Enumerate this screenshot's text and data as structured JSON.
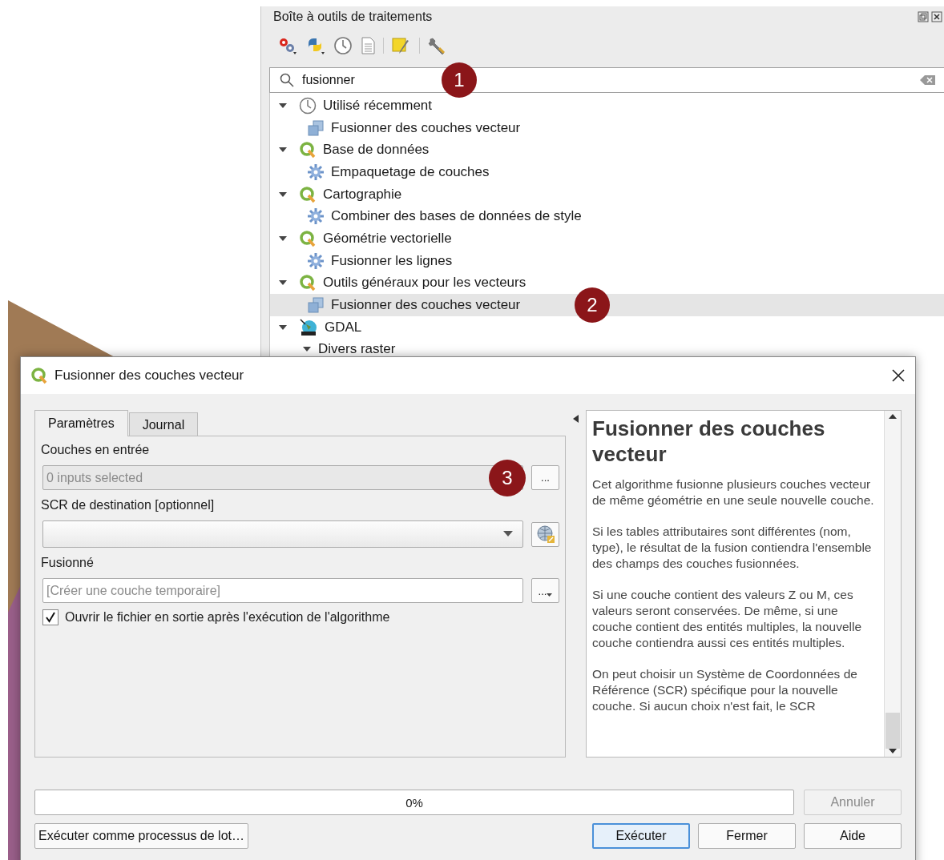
{
  "toolbox": {
    "title": "Boîte à outils de traitements",
    "search": {
      "value": "fusionner",
      "badge": "1"
    },
    "tree": [
      {
        "label": "Utilisé récemment",
        "kind": "recent",
        "expanded": true,
        "children": [
          {
            "label": "Fusionner des couches vecteur",
            "kind": "model",
            "selected": false
          }
        ]
      },
      {
        "label": "Base de données",
        "kind": "provider",
        "expanded": true,
        "children": [
          {
            "label": "Empaquetage de couches",
            "kind": "algorithm",
            "selected": false
          }
        ]
      },
      {
        "label": "Cartographie",
        "kind": "provider",
        "expanded": true,
        "children": [
          {
            "label": "Combiner des bases de données de style",
            "kind": "algorithm",
            "selected": false
          }
        ]
      },
      {
        "label": "Géométrie vectorielle",
        "kind": "provider",
        "expanded": true,
        "children": [
          {
            "label": "Fusionner les lignes",
            "kind": "algorithm",
            "selected": false
          }
        ]
      },
      {
        "label": "Outils généraux pour les vecteurs",
        "kind": "provider",
        "expanded": true,
        "children": [
          {
            "label": "Fusionner des couches vecteur",
            "kind": "model",
            "selected": true,
            "badge": "2"
          }
        ]
      },
      {
        "label": "GDAL",
        "kind": "gdal",
        "expanded": true,
        "children": [
          {
            "label": "Divers raster",
            "kind": "group",
            "expanded": true
          }
        ]
      }
    ]
  },
  "dialog": {
    "title": "Fusionner des couches vecteur",
    "tabs": [
      {
        "label": "Paramètres",
        "selected": true
      },
      {
        "label": "Journal",
        "selected": false
      }
    ],
    "params": [
      {
        "kind": "multi",
        "label": "Couches en entrée",
        "value": "0 inputs selected",
        "button": "...",
        "badge": "3"
      },
      {
        "kind": "crs",
        "label": "SCR de destination [optionnel]"
      },
      {
        "kind": "file",
        "label": "Fusionné",
        "placeholder": "[Créer une couche temporaire]",
        "button": "..."
      },
      {
        "kind": "checkbox",
        "label": "Ouvrir le fichier en sortie après l'exécution de l'algorithme",
        "checked": true
      }
    ],
    "help": {
      "title": "Fusionner des couches vecteur",
      "paragraphs": [
        "Cet algorithme fusionne plusieurs couches vecteur de même géométrie en une seule nouvelle couche.",
        "Si les tables attributaires sont différentes (nom, type), le résultat de la fusion contiendra l'ensemble des champs des couches fusionnées.",
        "Si une couche contient des valeurs Z ou M, ces valeurs seront conservées. De même, si une couche contient des entités multiples, la nouvelle couche contiendra aussi ces entités multiples.",
        "On peut choisir un Système de Coordonnées de Référence (SCR) spécifique pour la nouvelle couche. Si aucun choix n'est fait, le SCR"
      ]
    },
    "progress": {
      "level": 0,
      "text": "0%"
    },
    "cancel": {
      "label": "Annuler",
      "disabled": true
    },
    "batch": {
      "label": "Exécuter comme processus de lot…"
    },
    "buttons": [
      {
        "label": "Exécuter",
        "default": true
      },
      {
        "label": "Fermer",
        "default": false
      },
      {
        "label": "Aide",
        "default": false
      }
    ]
  }
}
